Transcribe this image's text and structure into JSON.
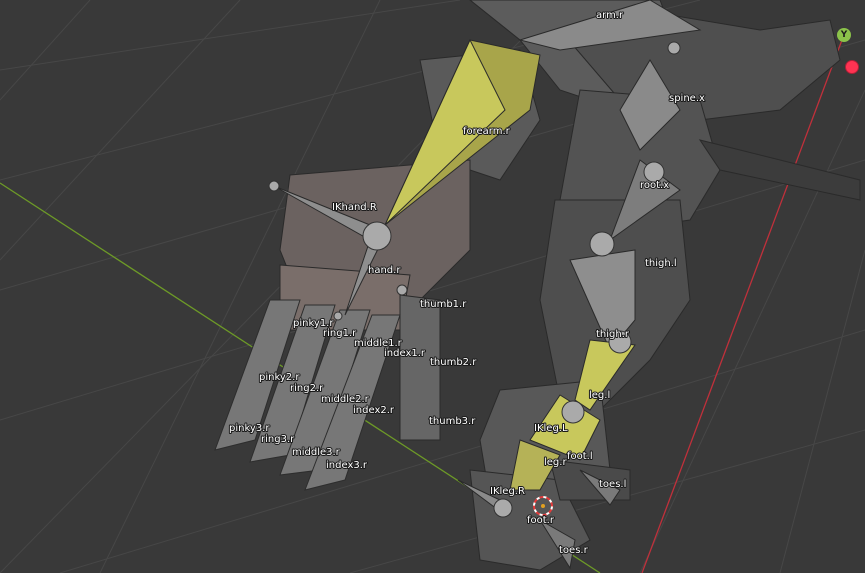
{
  "viewport": {
    "gizmo": {
      "y_axis_label": "Y",
      "y_color": "#8bc34a",
      "x_color": "#ff3352"
    },
    "colors": {
      "background": "#393939",
      "grid": "#4a4a4a",
      "x_axis_line": "#c0303b",
      "y_axis_line": "#6d9a27",
      "active_bone": "#c8c85c",
      "bone": "#7a7a7a"
    }
  },
  "bones": {
    "arm_r": "arm.r",
    "spine_x": "spine.x",
    "forearm_r": "forearm.r",
    "root_x": "root.x",
    "ikhand_r": "IKhand.R",
    "hand_r": "hand.r",
    "thigh_l": "thigh.l",
    "thumb1_r": "thumb1.r",
    "pinky1_r": "pinky1.r",
    "ring1_r": "ring1.r",
    "middle1_r": "middle1.r",
    "index1_r": "index1.r",
    "thigh_r": "thigh.r",
    "thumb2_r": "thumb2.r",
    "pinky2_r": "pinky2.r",
    "ring2_r": "ring2.r",
    "leg_l": "leg.l",
    "middle2_r": "middle2.r",
    "index2_r": "index2.r",
    "thumb3_r": "thumb3.r",
    "ikleg_l": "IKleg.L",
    "pinky3_r": "pinky3.r",
    "ring3_r": "ring3.r",
    "middle3_r": "middle3.r",
    "foot_l": "foot.l",
    "leg_r": "leg.r",
    "index3_r": "index3.r",
    "toes_l": "toes.l",
    "ikleg_r": "IKleg.R",
    "foot_r": "foot.r",
    "toes_r": "toes.r"
  }
}
